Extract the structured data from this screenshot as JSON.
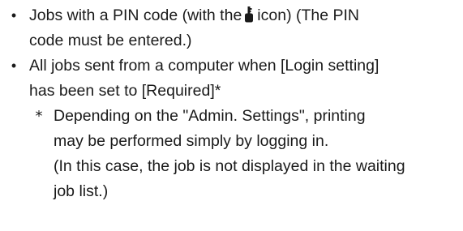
{
  "items": [
    {
      "line1_before_icon": "Jobs with a PIN code (with the",
      "icon": "lock-icon",
      "line1_after_icon": "icon) (The PIN",
      "line2": "code must be entered.)"
    },
    {
      "line1": "All jobs sent from a computer when [Login setting]",
      "line2": "has been set to [Required]*"
    }
  ],
  "bullet_glyph": "•",
  "note": {
    "mark": "*",
    "lines": [
      "Depending on the \"Admin. Settings\", printing",
      "may be performed simply by logging in.",
      "(In this case, the job is not displayed in the waiting",
      "job list.)"
    ]
  }
}
